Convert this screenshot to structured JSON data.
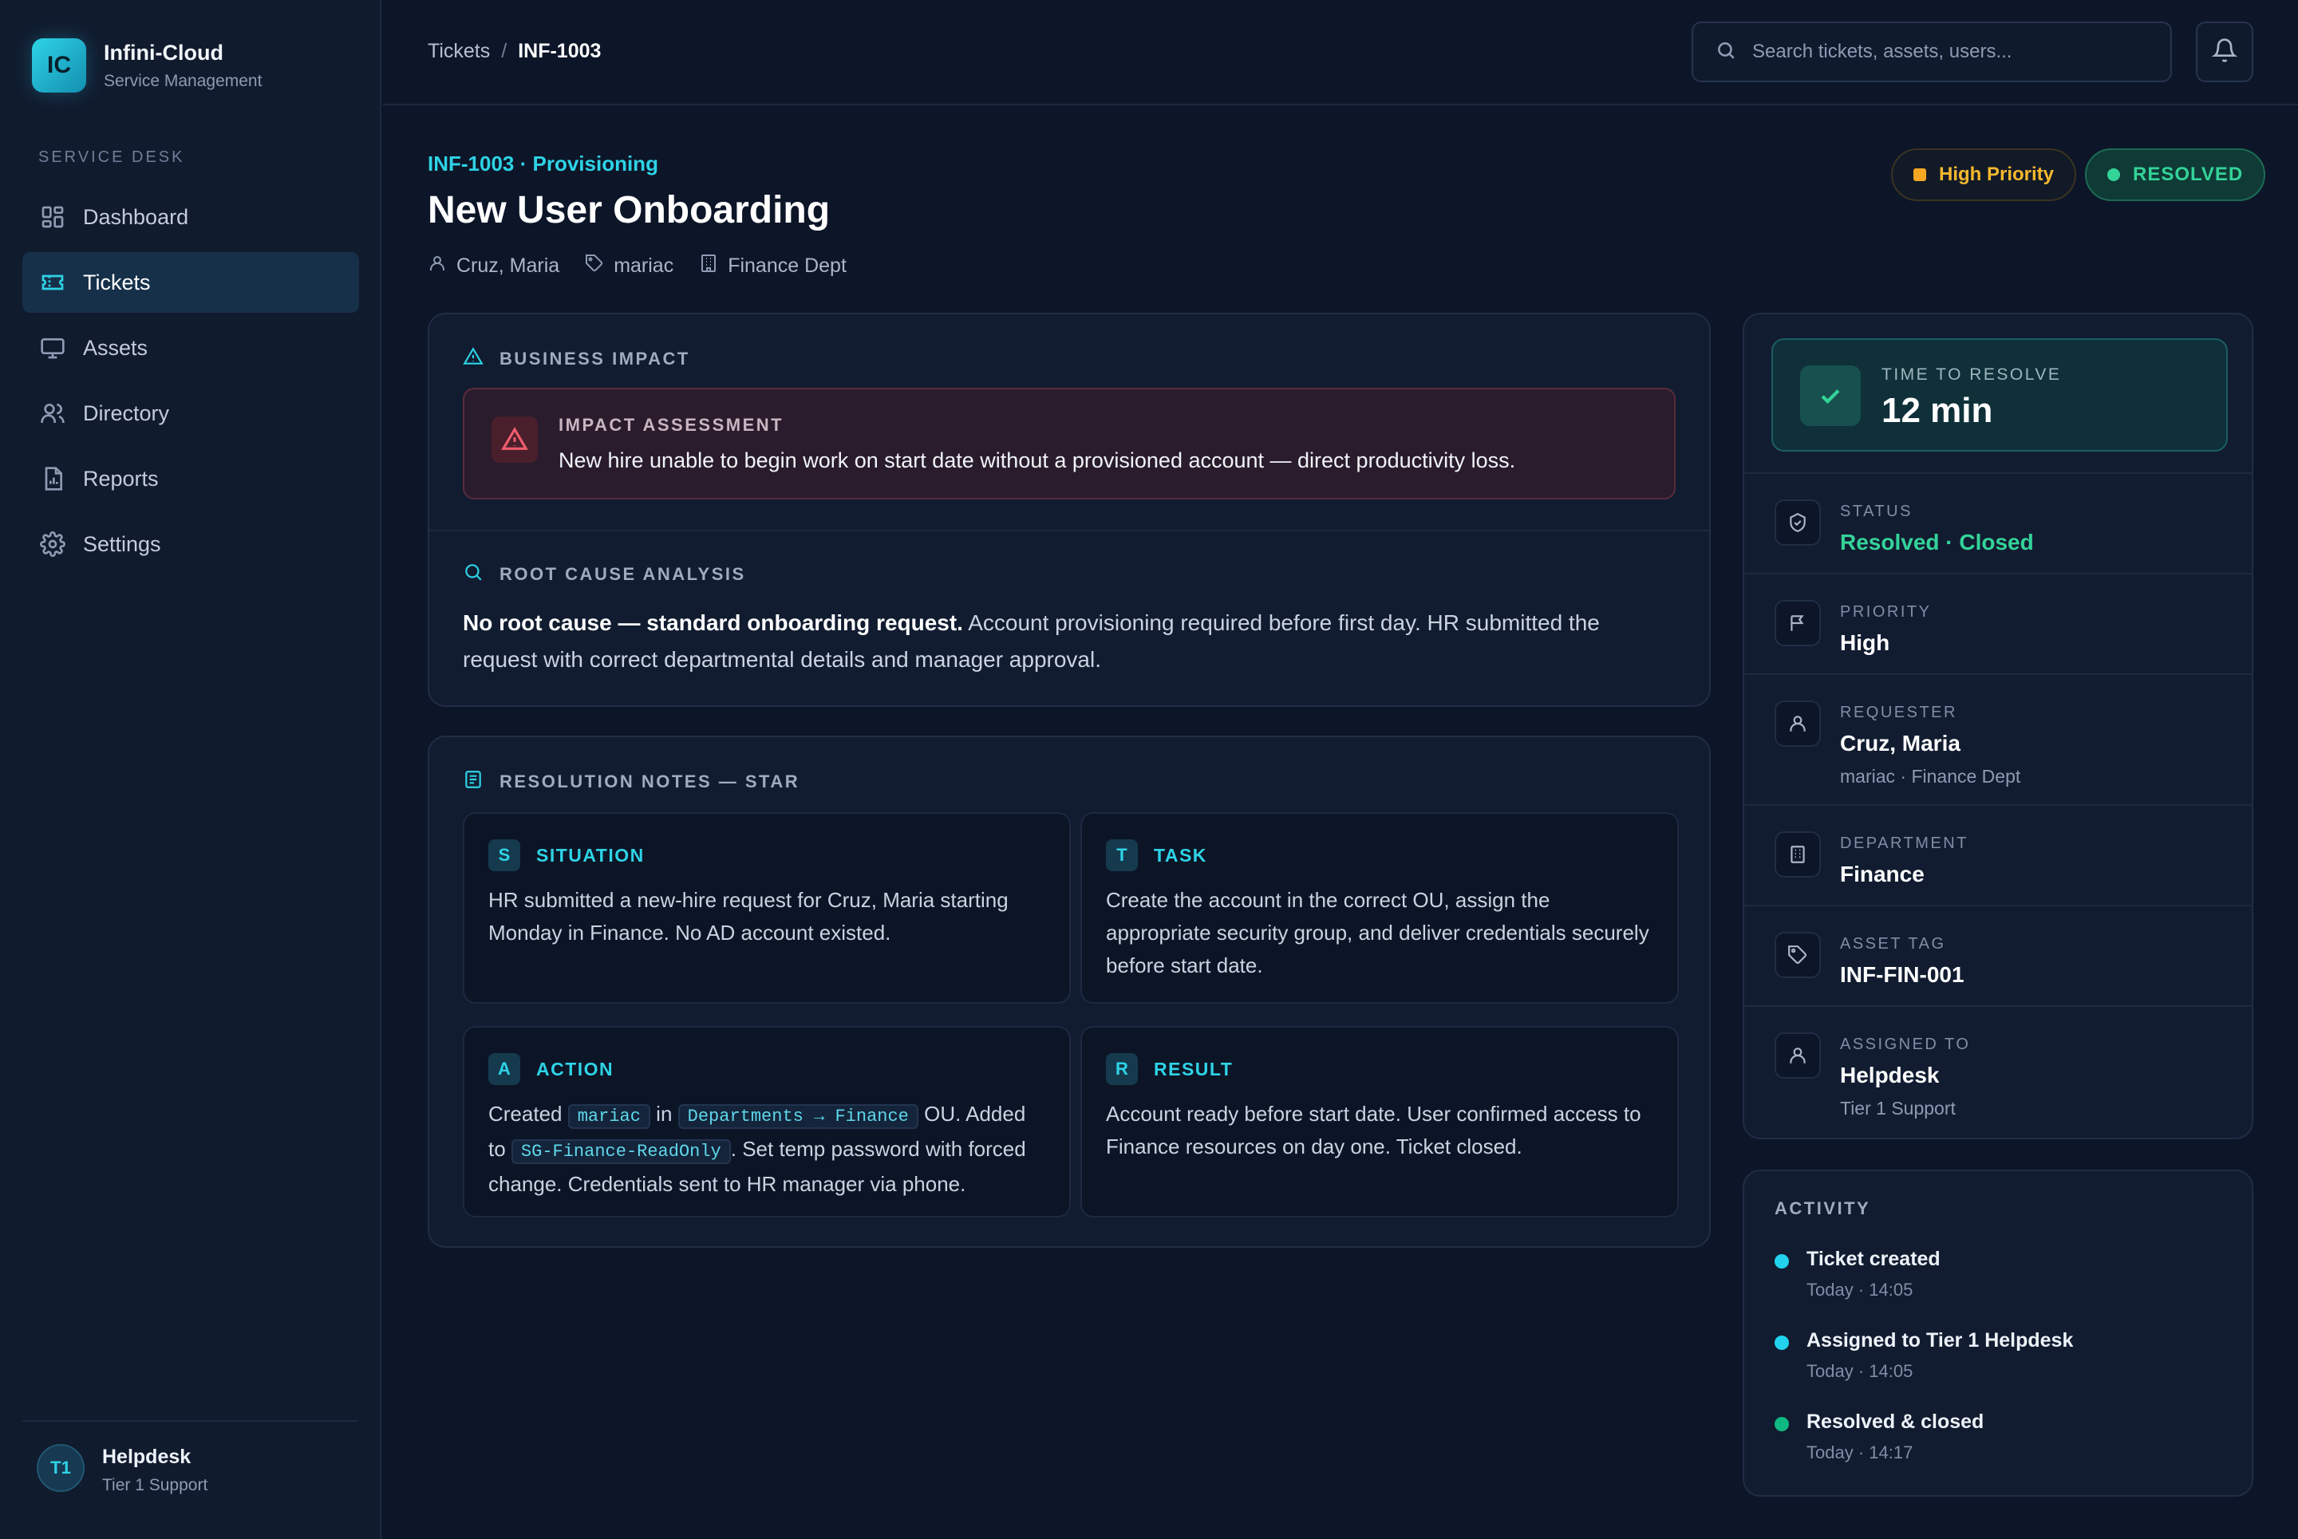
{
  "brand": {
    "logo": "IC",
    "name": "Infini-Cloud",
    "subtitle": "Service Management"
  },
  "sidebar": {
    "section": "SERVICE DESK",
    "items": [
      {
        "label": "Dashboard",
        "icon": "dashboard-icon"
      },
      {
        "label": "Tickets",
        "icon": "ticket-icon",
        "active": true
      },
      {
        "label": "Assets",
        "icon": "monitor-icon"
      },
      {
        "label": "Directory",
        "icon": "users-icon"
      },
      {
        "label": "Reports",
        "icon": "report-icon"
      },
      {
        "label": "Settings",
        "icon": "gear-icon"
      }
    ],
    "user": {
      "initials": "T1",
      "name": "Helpdesk",
      "role": "Tier 1 Support"
    }
  },
  "topbar": {
    "breadcrumb": [
      "Tickets",
      "INF-1003"
    ],
    "breadcrumb_sep": "/",
    "search_placeholder": "Search tickets, assets, users...",
    "bell_icon": "bell-icon"
  },
  "ticket": {
    "id_line": "INF-1003 · Provisioning",
    "title": "New User Onboarding",
    "meta": {
      "person": "Cruz, Maria",
      "tag": "mariac",
      "dept": "Finance Dept"
    },
    "priority_badge": "High Priority",
    "status_badge": "RESOLVED"
  },
  "impact": {
    "title": "BUSINESS IMPACT",
    "box_label": "IMPACT ASSESSMENT",
    "box_text": "New hire unable to begin work on start date without a provisioned account — direct productivity loss."
  },
  "rca": {
    "title": "ROOT CAUSE ANALYSIS",
    "lead": "No root cause — standard onboarding request.",
    "text": " Account provisioning required before first day. HR submitted the request with correct departmental details and manager approval."
  },
  "star": {
    "title": "RESOLUTION NOTES — STAR",
    "situation": {
      "letter": "S",
      "label": "SITUATION",
      "text": "HR submitted a new-hire request for Cruz, Maria starting Monday in Finance. No AD account existed."
    },
    "task": {
      "letter": "T",
      "label": "TASK",
      "text": "Create the account in the correct OU, assign the appropriate security group, and deliver credentials securely before start date."
    },
    "action": {
      "letter": "A",
      "label": "ACTION",
      "t1": "Created ",
      "c1": "mariac",
      "t2": " in ",
      "c2": "Departments → Finance",
      "t3": " OU. Added to ",
      "c3": "SG-Finance-ReadOnly",
      "t4": ". Set temp password with forced change. Credentials sent to HR manager via phone."
    },
    "result": {
      "letter": "R",
      "label": "RESULT",
      "text": "Account ready before start date. User confirmed access to Finance resources on day one. Ticket closed."
    }
  },
  "details": {
    "ttr_label": "TIME TO RESOLVE",
    "ttr_value": "12 min",
    "status_label": "STATUS",
    "status_value": "Resolved · Closed",
    "priority_label": "PRIORITY",
    "priority_value": "High",
    "requester_label": "REQUESTER",
    "requester_value": "Cruz, Maria",
    "requester_sub": "mariac · Finance Dept",
    "department_label": "DEPARTMENT",
    "department_value": "Finance",
    "asset_label": "ASSET TAG",
    "asset_value": "INF-FIN-001",
    "assigned_label": "ASSIGNED TO",
    "assigned_value": "Helpdesk",
    "assigned_sub": "Tier 1 Support"
  },
  "activity": {
    "title": "ACTIVITY",
    "items": [
      {
        "text": "Ticket created",
        "time": "Today · 14:05",
        "color": "#22d3ee"
      },
      {
        "text": "Assigned to Tier 1 Helpdesk",
        "time": "Today · 14:05",
        "color": "#22d3ee"
      },
      {
        "text": "Resolved & closed",
        "time": "Today · 14:17",
        "color": "#10b981"
      }
    ]
  },
  "colors": {
    "accent": "#2ed3e6",
    "success": "#34d399",
    "warning": "#f5a623",
    "danger": "#f25d6e",
    "background": "#0d1628"
  }
}
